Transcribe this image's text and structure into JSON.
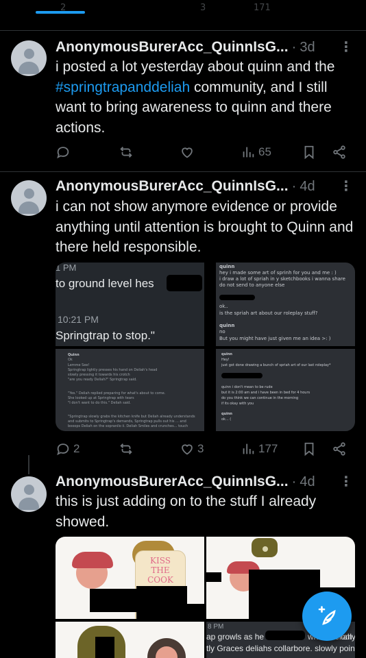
{
  "top_partial_counts": [
    "2",
    "3",
    "171"
  ],
  "posts": [
    {
      "display_name": "AnonymousBurerAcc_QuinnIsG...",
      "separator": "·",
      "time": "3d",
      "text_before": "i posted a lot yesterday about quinn and the ",
      "hashtag": "#springtrapanddeliah",
      "text_after": " community, and I still want to bring awareness to quinn and there actions.",
      "actions": {
        "replies": "",
        "reposts": "",
        "likes": "",
        "views": "65"
      }
    },
    {
      "display_name": "AnonymousBurerAcc_QuinnIsG...",
      "separator": "·",
      "time": "4d",
      "text": "i can not show anymore evidence or provide anything until attention is brought to Quinn and there held responsible.",
      "media": {
        "tile1_lines": [
          "1 PM",
          "to ground level hes",
          "10:21 PM",
          "Springtrap to stop.\""
        ],
        "tile2_lines": [
          "quinn",
          "hey i made some art of sprinh for you and me : )",
          "i draw a lot of spriah in y sketchbooks i wanna share",
          "do not send to anyone else",
          "ok..",
          "is the spriah art about our roleplay stuff?",
          "quinn",
          "no",
          "But you might have just given me an idea >: )"
        ],
        "tile3_lines": [
          "Quinn",
          "Ok",
          "Lemme See!",
          "Springtrap lightly presses his hand on Deliah's head",
          "slowly pressing it towards his crotch",
          "\"are you ready Deliah?\" Springtrap said.",
          "\"Yes.\" Deliah replied preparing for what's about to come.",
          "She looked up at Springtrap with tears",
          "\"I don't want to do this.\" Deliah said.",
          "\"Springtrap slowly grabs the kitchen knife but Deliah already understands and submits to Springtrap's demands, Springtrap pulls out his ... and booops Deliah on the sopranilo ii. Deliah Smiles and crunches... touch"
        ],
        "tile4_lines": [
          "quinn",
          "Hey!",
          "just got done drawing a bunch of spriah art of our last roleplay*",
          "quinn i don't mean to be rude",
          "but it is 2:00 am and i have been in bed for 4 hours",
          "do you think we can continue in the morning",
          "if its okay with you",
          "quinn",
          "ok... ("
        ]
      },
      "actions": {
        "replies": "2",
        "reposts": "",
        "likes": "3",
        "views": "177"
      }
    },
    {
      "display_name": "AnonymousBurerAcc_QuinnIsG...",
      "separator": "·",
      "time": "4d",
      "text": "this is just adding on to the stuff I already showed.",
      "media": {
        "shirt_text": [
          "KISS",
          "THE",
          "COOK"
        ],
        "tile4_lines": [
          "8 PM",
          "ap growls as he",
          "while Deliah",
          "only",
          "tly Graces deliahs collarbore. slowly pointin"
        ]
      }
    }
  ],
  "icons": {
    "reply": "reply-icon",
    "repost": "repost-icon",
    "like": "heart-icon",
    "views": "views-icon",
    "bookmark": "bookmark-icon",
    "share": "share-icon",
    "more": "more-icon",
    "compose": "compose-icon"
  },
  "colors": {
    "background": "#000000",
    "text": "#e7e9ea",
    "muted": "#71767b",
    "accent": "#1d9bf0",
    "divider": "#2f3336"
  }
}
